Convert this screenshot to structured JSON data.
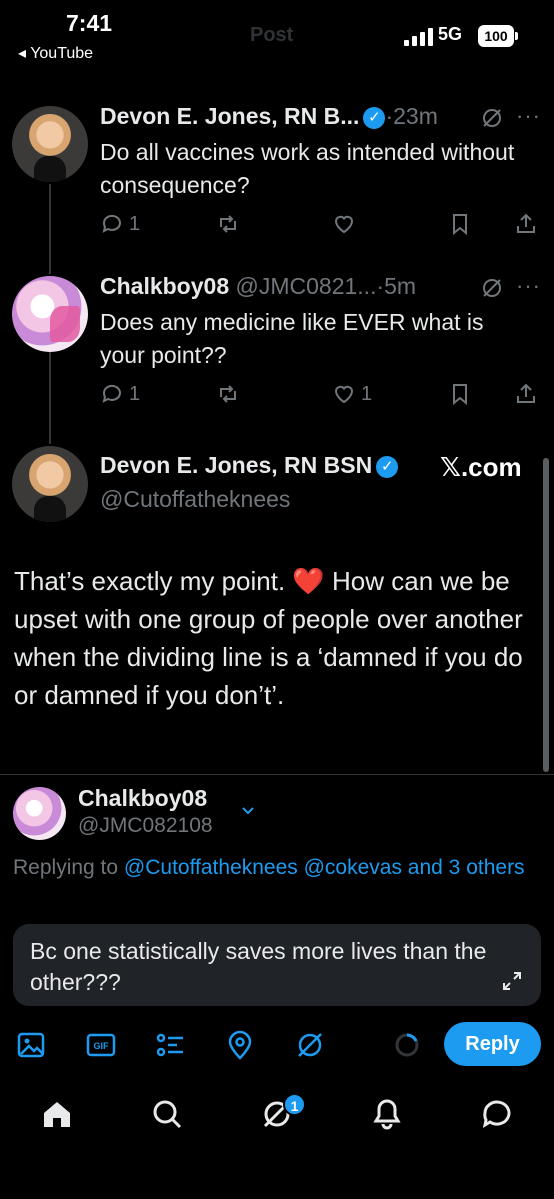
{
  "status_bar": {
    "time": "7:41",
    "back_label": "◂ YouTube",
    "faded_title": "Post",
    "network": "5G",
    "battery": "100"
  },
  "posts": [
    {
      "name": "Devon E. Jones, RN B...",
      "time": "·23m",
      "text": "Do all vaccines work as intended without consequence?",
      "replies": "1",
      "reposts": "",
      "likes": ""
    },
    {
      "name": "Chalkboy08",
      "handle": "@JMC0821...",
      "time": "·5m",
      "text": "Does any medicine like EVER what is your point??",
      "replies": "1",
      "reposts": "",
      "likes": "1"
    }
  ],
  "main_post": {
    "name": "Devon E. Jones, RN BSN",
    "handle": "@Cutoffatheknees",
    "source": "𝕏.com",
    "text": "That’s exactly my point. ❤️ How can we be upset with one group of people over another when the dividing line is a ‘damned if you do or damned if you don’t’."
  },
  "compose": {
    "name": "Chalkboy08",
    "handle": "@JMC082108",
    "replying_prefix": "Replying to ",
    "replying_mentions": "@Cutoffatheknees @cokevas and 3 others",
    "text": "Bc one statistically saves more lives than the other???",
    "reply_label": "Reply"
  },
  "nav": {
    "grok_badge": "1"
  },
  "colors": {
    "accent": "#1d9bf0",
    "background": "#000000",
    "muted": "#71767b",
    "like_red": "#f91880"
  }
}
